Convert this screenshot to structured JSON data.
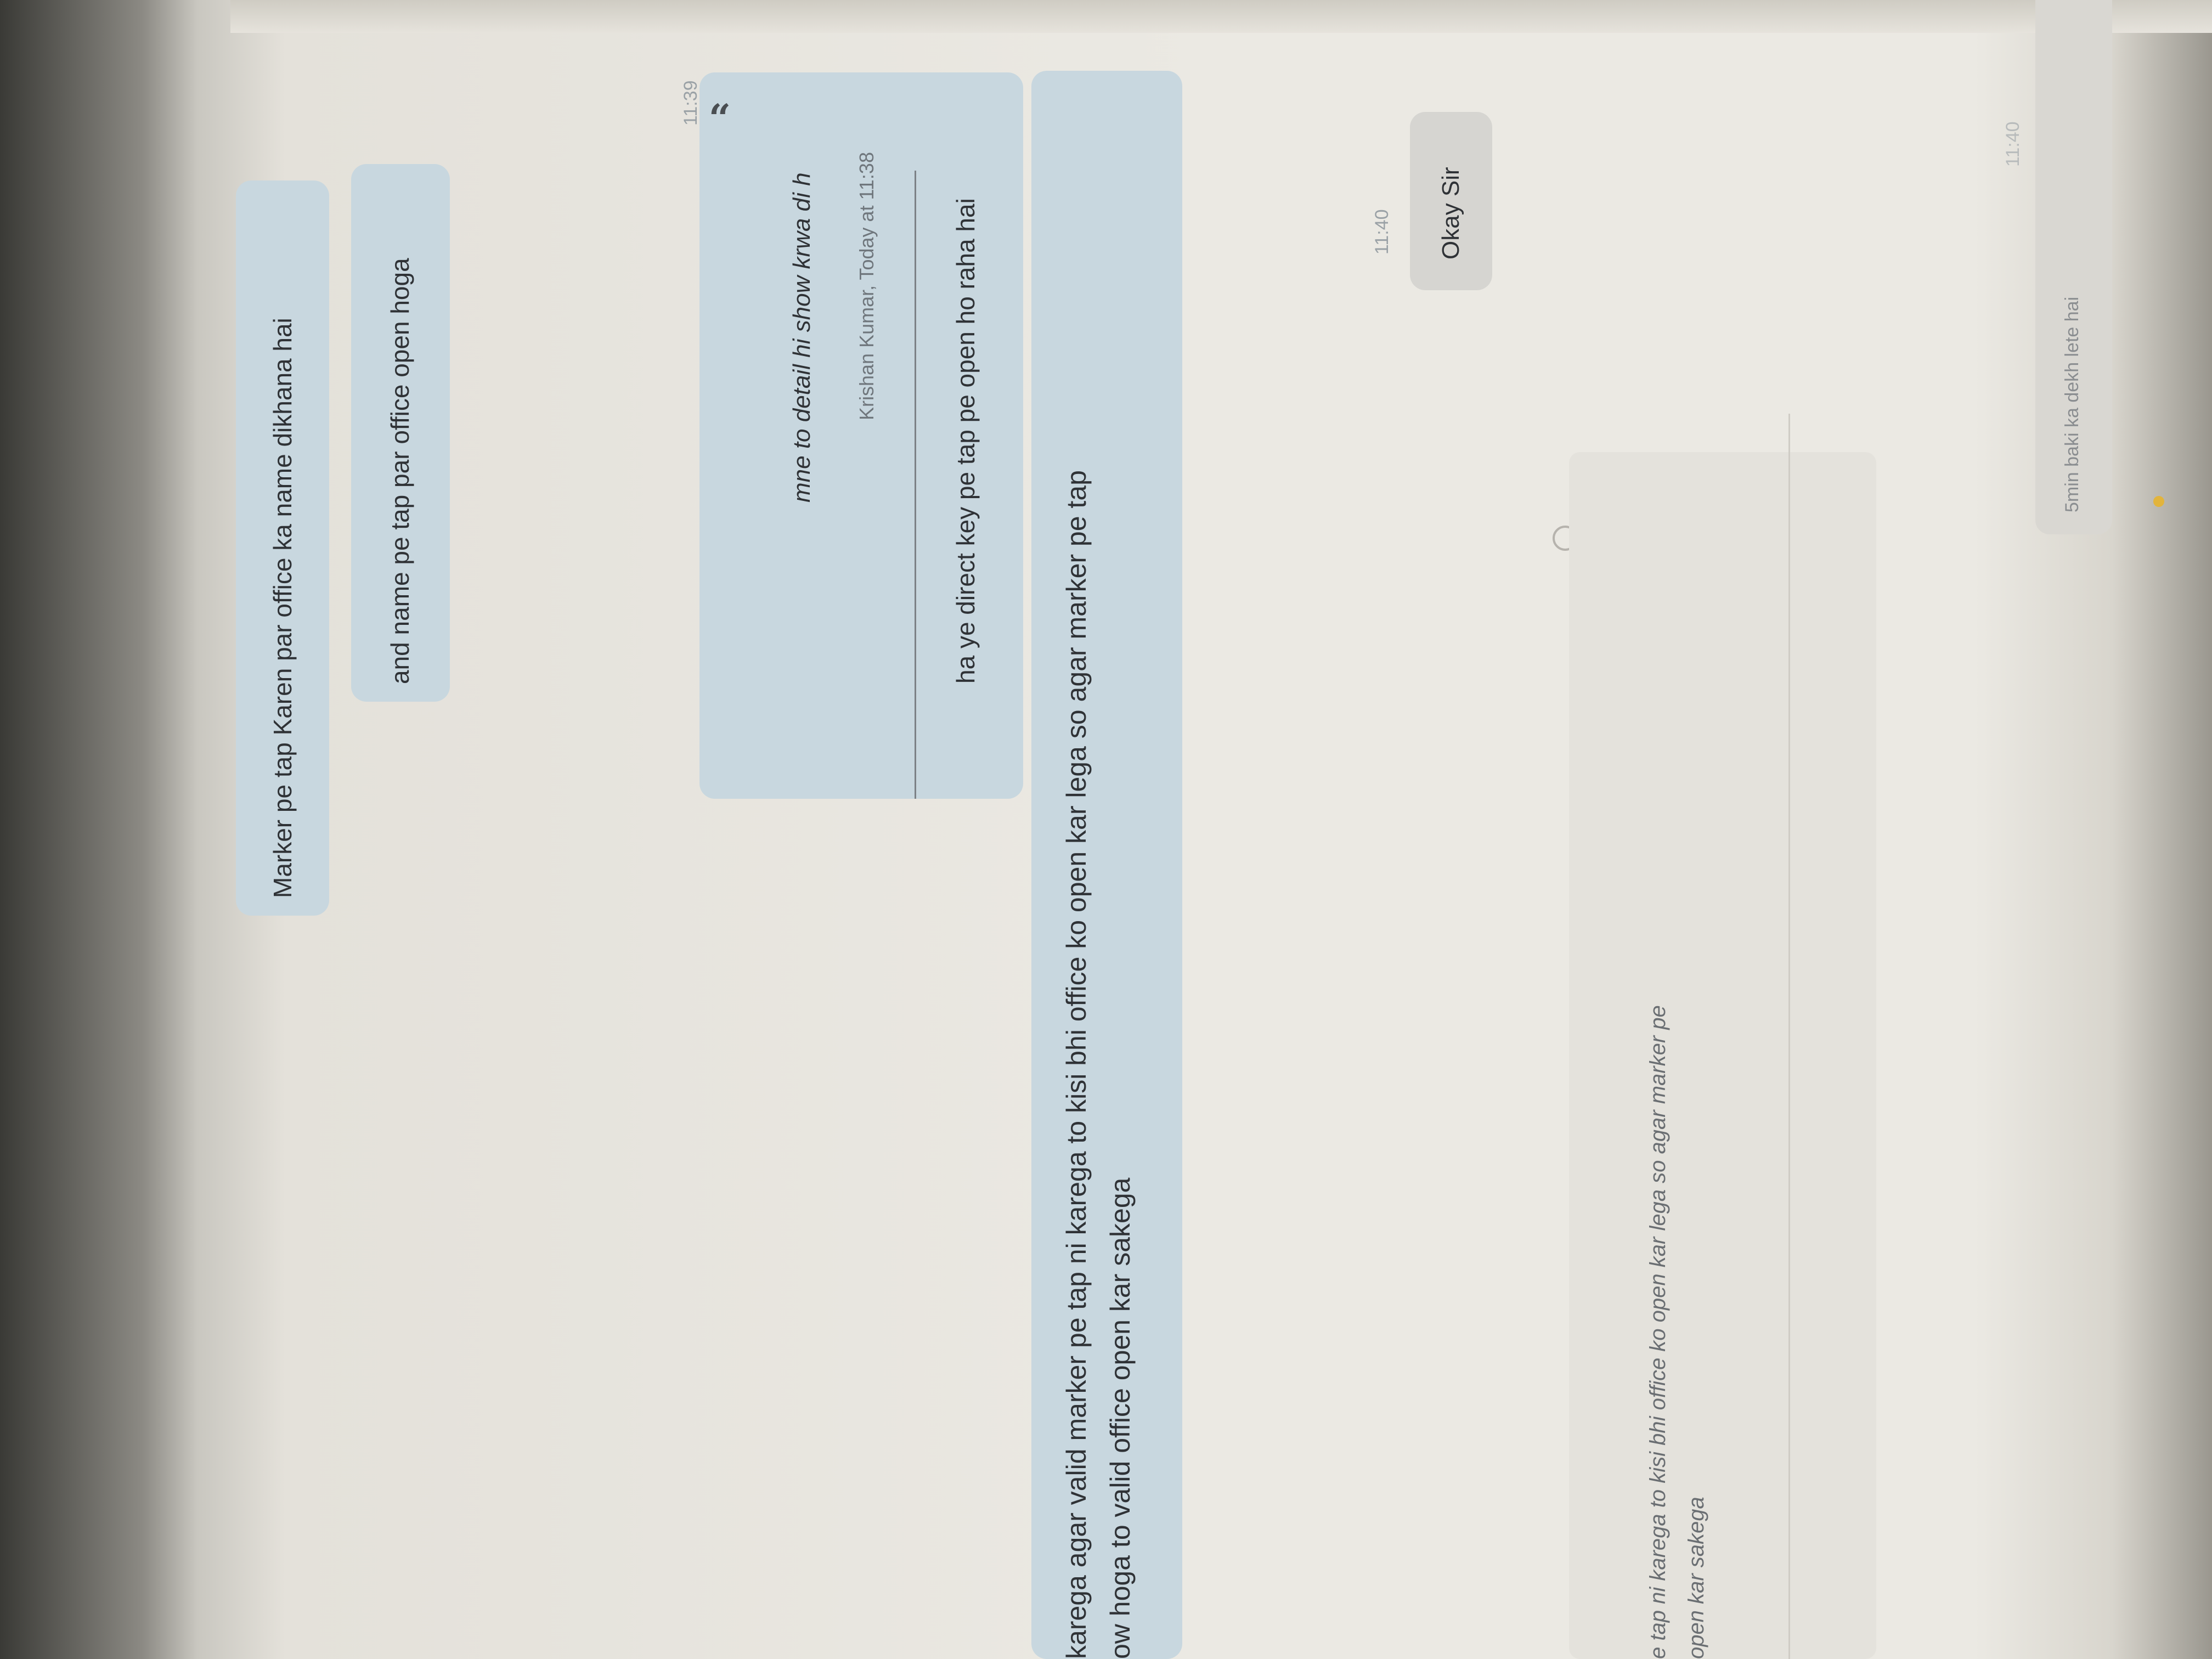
{
  "messages": {
    "m1": {
      "text": "Marker pe tap Karen par office ka name dikhana hai"
    },
    "m2": {
      "text": "and name pe tap par office open hoga"
    },
    "m3": {
      "quote_text": "mne to detail hi show krwa di h",
      "quote_meta": "Krishan Kumar, Today at 11:38",
      "text": "ha ye direct key pe tap pe open ho raha hai",
      "time": "11:39"
    },
    "m4": {
      "line1": "karega agar valid marker pe tap ni karega to kisi bhi office ko open kar lega so agar marker pe tap",
      "line2": "ow hoga to valid office open kar sakega"
    },
    "m5": {
      "text": "Okay Sir",
      "time": "11:40"
    },
    "draft": {
      "line1": "e tap ni karega to kisi bhi office ko open kar lega so agar marker pe",
      "line2": "open kar sakega"
    },
    "m6": {
      "text": "5min baki ka dekh lete hai",
      "time": "11:40"
    }
  },
  "colors": {
    "outgoing_bubble": "#c8d7df",
    "incoming_bubble": "#d6d5d1",
    "background": "#ebe9e3"
  }
}
